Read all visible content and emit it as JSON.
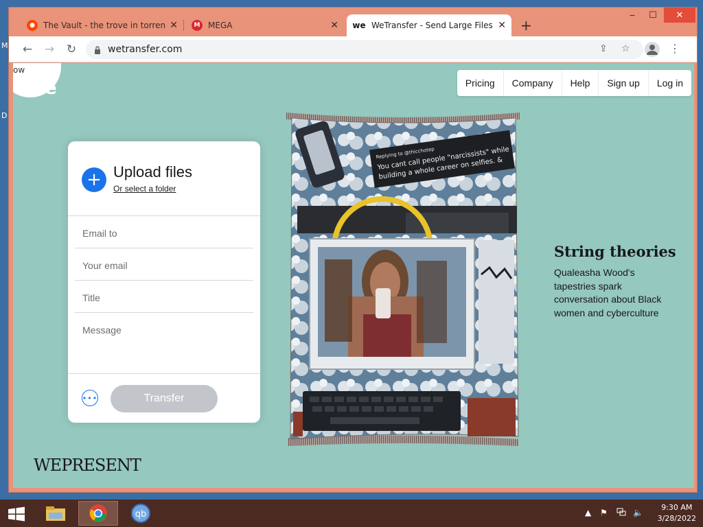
{
  "desktop": {
    "edge_text_1": "M",
    "edge_text_2": "D"
  },
  "browser": {
    "tabs": [
      {
        "title": "The Vault - the trove in torrent fo",
        "favicon": "reddit-icon",
        "color": "#ff4500"
      },
      {
        "title": "MEGA",
        "favicon": "mega-icon",
        "color": "#d9272e"
      },
      {
        "title": "WeTransfer - Send Large Files &",
        "favicon": "wetransfer-icon",
        "active": true
      }
    ],
    "new_tab": "+",
    "window_controls": {
      "minimize": "‒",
      "maximize": "☐",
      "close": "✕"
    },
    "url": "wetransfer.com"
  },
  "wetransfer": {
    "logo_partial_text": "ow",
    "logo_mark": "we",
    "nav": [
      "Pricing",
      "Company",
      "Help",
      "Sign up",
      "Log in"
    ],
    "upload": {
      "title": "Upload files",
      "folder_link": "Or select a folder",
      "fields": {
        "email_to": "Email to",
        "your_email": "Your email",
        "title": "Title",
        "message": "Message"
      },
      "more_options": "•••",
      "transfer_label": "Transfer"
    },
    "story": {
      "tweet_reply": "Replying to @thicchotep",
      "tweet_text": "You cant call people \"narcissists\" while building a whole career on selfies. &",
      "title": "String theories",
      "text": "Qualeasha Wood's tapestries spark conversation about Black women and cyberculture"
    },
    "wepresent": "WEPRESENT"
  },
  "taskbar": {
    "apps": [
      "file-explorer-icon",
      "chrome-icon",
      "qbittorrent-icon"
    ],
    "qb_label": "qb",
    "time": "9:30 AM",
    "date": "3/28/2022",
    "tray_arrow": "▲",
    "tray_flag": "⚑",
    "tray_speaker": "🔈"
  }
}
